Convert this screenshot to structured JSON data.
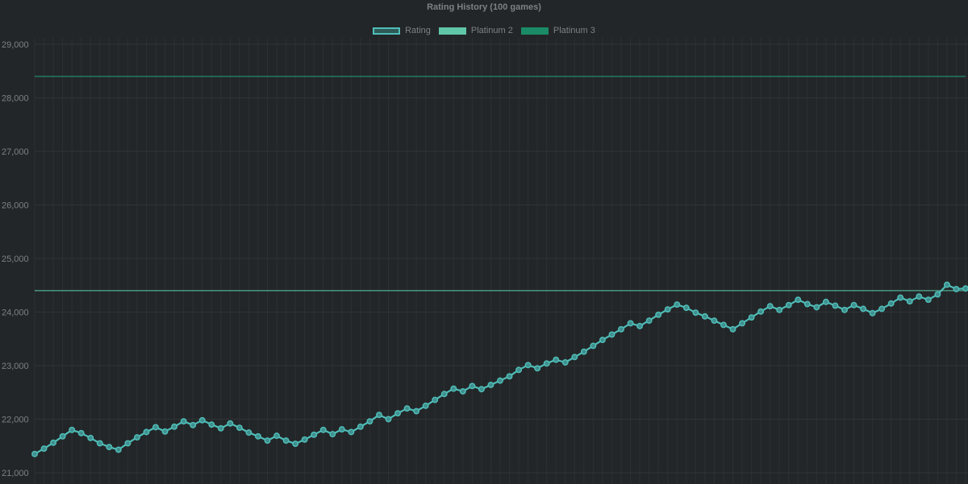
{
  "chart_data": {
    "type": "line",
    "title": "Rating History (100 games)",
    "ylim": [
      21000,
      29000
    ],
    "y_ticks": [
      "21,000",
      "22,000",
      "23,000",
      "24,000",
      "25,000",
      "26,000",
      "27,000",
      "28,000",
      "29,000"
    ],
    "grid": true,
    "legend_position": "top",
    "series": [
      {
        "name": "Rating",
        "color": "#4fbdb8",
        "values": [
          21350,
          21450,
          21560,
          21680,
          21800,
          21740,
          21650,
          21550,
          21480,
          21430,
          21550,
          21660,
          21760,
          21850,
          21770,
          21860,
          21960,
          21890,
          21980,
          21900,
          21830,
          21920,
          21840,
          21750,
          21680,
          21600,
          21690,
          21600,
          21540,
          21620,
          21710,
          21800,
          21720,
          21810,
          21760,
          21860,
          21960,
          22080,
          22000,
          22110,
          22200,
          22150,
          22250,
          22360,
          22470,
          22570,
          22520,
          22620,
          22560,
          22640,
          22720,
          22800,
          22920,
          23010,
          22950,
          23040,
          23110,
          23060,
          23160,
          23260,
          23370,
          23480,
          23580,
          23680,
          23790,
          23740,
          23840,
          23950,
          24050,
          24140,
          24080,
          23990,
          23920,
          23840,
          23760,
          23680,
          23790,
          23900,
          24010,
          24110,
          24040,
          24130,
          24230,
          24150,
          24090,
          24190,
          24120,
          24040,
          24130,
          24060,
          23980,
          24060,
          24160,
          24270,
          24200,
          24290,
          24230,
          24330,
          24510,
          24430,
          24440
        ]
      },
      {
        "name": "Platinum 2",
        "color": "#5fc6a7",
        "values": [
          24400
        ]
      },
      {
        "name": "Platinum 3",
        "color": "#1a8b66",
        "values": [
          28400
        ]
      }
    ]
  }
}
